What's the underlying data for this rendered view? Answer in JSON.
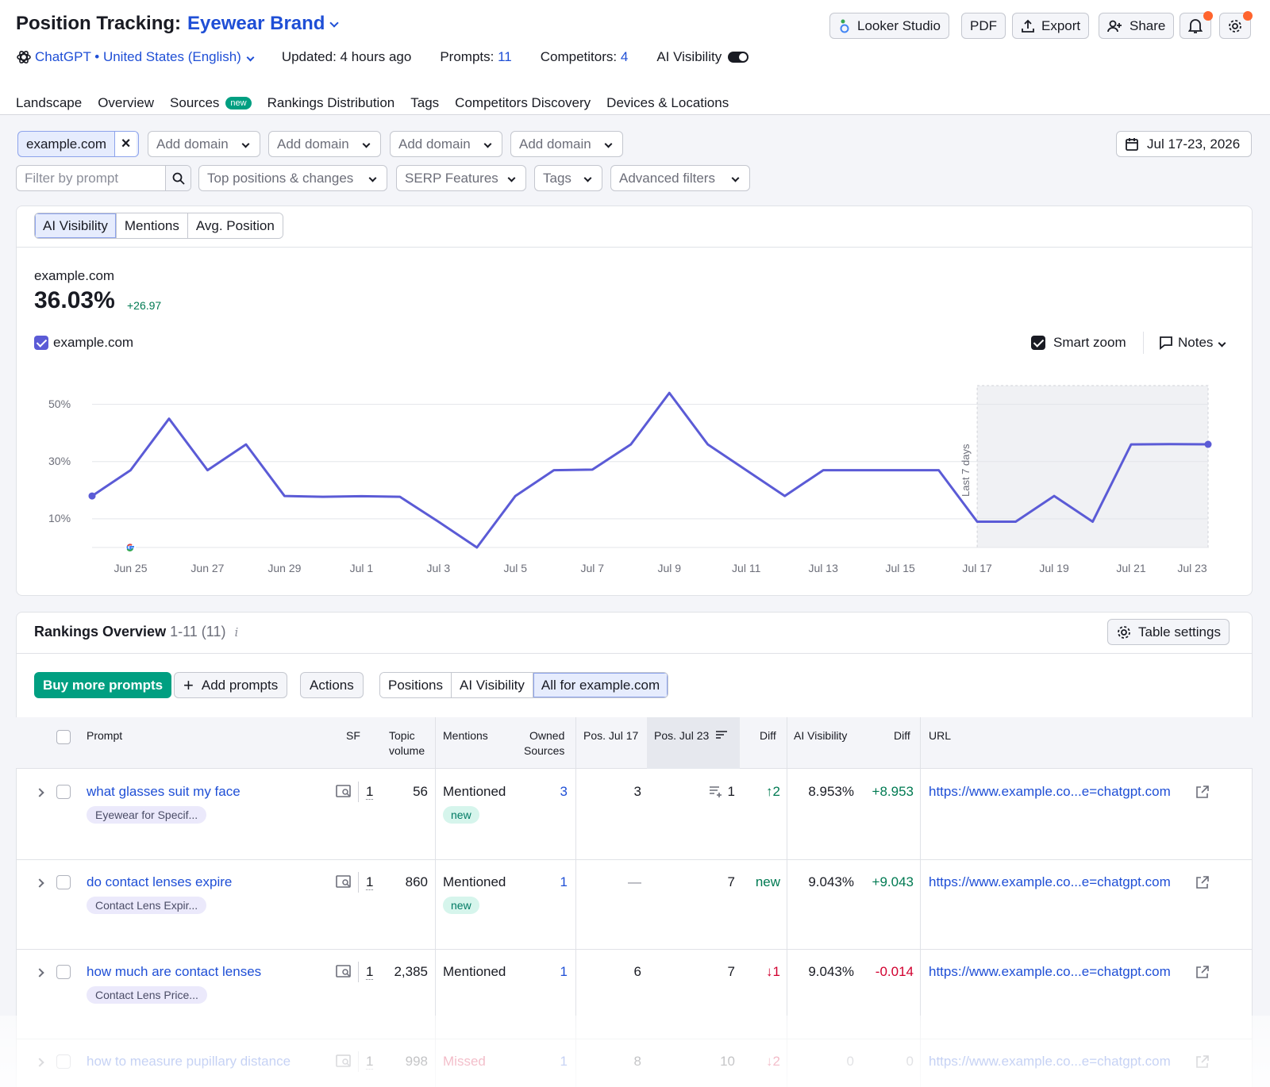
{
  "header": {
    "title": "Position Tracking:",
    "brand": "Eyewear Brand",
    "engine": "ChatGPT • United States (English)",
    "updated": "Updated: 4 hours ago",
    "prompts_label": "Prompts:",
    "prompts_count": "11",
    "competitors_label": "Competitors:",
    "competitors_count": "4",
    "ai_visibility_label": "AI Visibility",
    "buttons": {
      "looker": "Looker Studio",
      "pdf": "PDF",
      "export": "Export",
      "share": "Share"
    }
  },
  "tabs": [
    "Landscape",
    "Overview",
    "Sources",
    "Rankings Distribution",
    "Tags",
    "Competitors Discovery",
    "Devices & Locations"
  ],
  "tab_badge": "new",
  "filters": {
    "domain_chip": "example.com",
    "add_domain": "Add domain",
    "date_range": "Jul 17-23, 2026",
    "prompt_placeholder": "Filter by prompt",
    "top_positions": "Top positions & changes",
    "serp": "SERP Features",
    "tags": "Tags",
    "advanced": "Advanced filters"
  },
  "chart_card": {
    "metric_tabs": [
      "AI Visibility",
      "Mentions",
      "Avg. Position"
    ],
    "domain": "example.com",
    "value": "36.03%",
    "delta": "+26.97",
    "legend": "example.com",
    "smart_zoom": "Smart zoom",
    "notes": "Notes",
    "last7": "Last 7 days",
    "accent": "#5b5bd6"
  },
  "chart_data": {
    "type": "line",
    "x": [
      "Jun 24",
      "Jun 25",
      "Jun 26",
      "Jun 27",
      "Jun 28",
      "Jun 29",
      "Jun 30",
      "Jul 1",
      "Jul 2",
      "Jul 3",
      "Jul 4",
      "Jul 5",
      "Jul 6",
      "Jul 7",
      "Jul 8",
      "Jul 9",
      "Jul 10",
      "Jul 11",
      "Jul 12",
      "Jul 13",
      "Jul 14",
      "Jul 15",
      "Jul 16",
      "Jul 17",
      "Jul 18",
      "Jul 19",
      "Jul 20",
      "Jul 21",
      "Jul 22",
      "Jul 23"
    ],
    "series": [
      {
        "name": "example.com",
        "values": [
          18,
          27,
          45,
          27,
          36,
          18,
          17.7,
          17.9,
          17.7,
          9,
          0,
          18,
          27,
          27.2,
          36,
          54,
          36,
          27,
          18,
          27,
          27,
          27,
          27,
          9,
          9,
          18,
          9,
          36,
          36.1,
          36.03
        ]
      }
    ],
    "xticks": [
      "Jun 25",
      "Jun 27",
      "Jun 29",
      "Jul 1",
      "Jul 3",
      "Jul 5",
      "Jul 7",
      "Jul 9",
      "Jul 11",
      "Jul 13",
      "Jul 15",
      "Jul 17",
      "Jul 19",
      "Jul 21",
      "Jul 23"
    ],
    "yticks": [
      "50%",
      "30%",
      "10%"
    ],
    "ylim": [
      0,
      56
    ],
    "highlight_from": "Jul 17",
    "grid": true
  },
  "rankings": {
    "title": "Rankings Overview",
    "range": "1-11 (11)",
    "table_settings": "Table settings",
    "buy_more": "Buy more prompts",
    "add_prompts": "Add prompts",
    "actions": "Actions",
    "view_tabs": [
      "Positions",
      "AI Visibility",
      "All for example.com"
    ],
    "columns": {
      "prompt": "Prompt",
      "sf": "SF",
      "topic1": "Topic",
      "topic2": "volume",
      "mentions": "Mentions",
      "owned1": "Owned",
      "owned2": "Sources",
      "pos17": "Pos. Jul 17",
      "pos23": "Pos. Jul 23",
      "diff": "Diff",
      "ai_vis": "AI Visibility",
      "diff2": "Diff",
      "url": "URL"
    },
    "rows": [
      {
        "prompt": "what glasses suit my face",
        "tag": "Eyewear for Specif...",
        "sf": "1",
        "volume": "56",
        "mention": "Mentioned",
        "badge": "new",
        "owned": "3",
        "pos17": "3",
        "pos23": "1",
        "diff": "↑2",
        "ai": "8.953%",
        "ai_diff": "+8.953",
        "url": "https://www.example.co...e=chatgpt.com"
      },
      {
        "prompt": "do contact lenses expire",
        "tag": "Contact Lens Expir...",
        "sf": "1",
        "volume": "860",
        "mention": "Mentioned",
        "badge": "new",
        "owned": "1",
        "pos17": "—",
        "pos23": "7",
        "diff": "new",
        "ai": "9.043%",
        "ai_diff": "+9.043",
        "url": "https://www.example.co...e=chatgpt.com"
      },
      {
        "prompt": "how much are contact lenses",
        "tag": "Contact Lens Price...",
        "sf": "1",
        "volume": "2,385",
        "mention": "Mentioned",
        "badge": "",
        "owned": "1",
        "pos17": "6",
        "pos23": "7",
        "diff": "↓1",
        "ai": "9.043%",
        "ai_diff": "-0.014",
        "url": "https://www.example.co...e=chatgpt.com"
      },
      {
        "prompt": "how to measure pupillary distance",
        "tag": "",
        "sf": "1",
        "volume": "998",
        "mention": "Missed",
        "badge": "",
        "owned": "1",
        "pos17": "8",
        "pos23": "10",
        "diff": "↓2",
        "ai": "0",
        "ai_diff": "0",
        "url": "https://www.example.co...e=chatgpt.com"
      }
    ]
  }
}
